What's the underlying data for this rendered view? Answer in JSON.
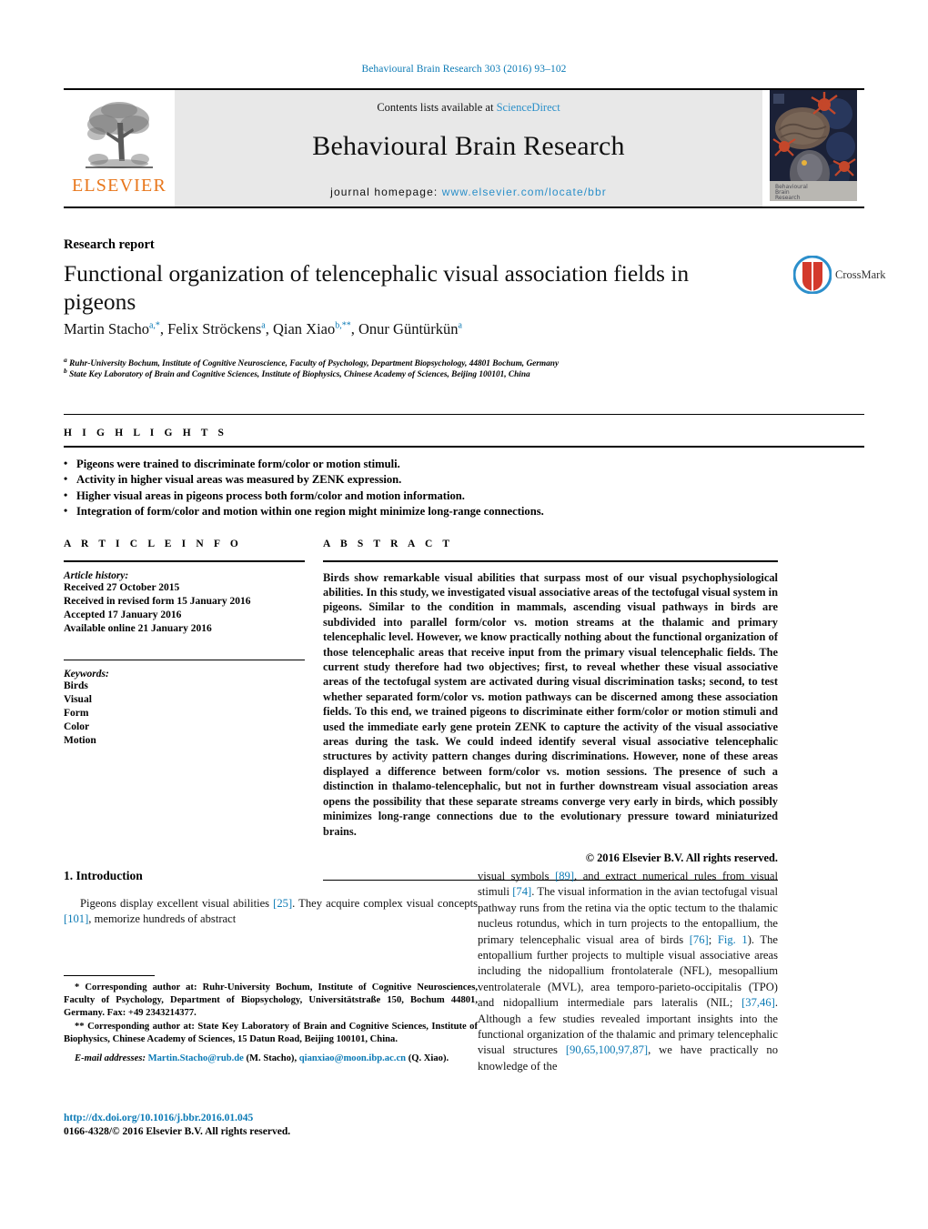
{
  "running_head": "Behavioural Brain Research 303 (2016) 93–102",
  "masthead": {
    "contents_prefix": "Contents lists available at ",
    "sciencedirect": "ScienceDirect",
    "journal_title": "Behavioural Brain Research",
    "homepage_prefix": "journal homepage: ",
    "homepage_url": "www.elsevier.com/locate/bbr",
    "publisher_wordmark": "ELSEVIER",
    "cover_caption_line1": "Behavioural",
    "cover_caption_line2": "Brain",
    "cover_caption_line3": "Research"
  },
  "article": {
    "kind": "Research report",
    "title": "Functional organization of telencephalic visual association fields in pigeons",
    "authors_html": "Martin Stacho<sup>a,*</sup>, Felix Ströckens<sup>a</sup>, Qian Xiao<sup>b,**</sup>, Onur Güntürkün<sup>a</sup>",
    "affiliation_a": "Ruhr-University Bochum, Institute of Cognitive Neuroscience, Faculty of Psychology, Department Biopsychology, 44801 Bochum, Germany",
    "affiliation_b": "State Key Laboratory of Brain and Cognitive Sciences, Institute of Biophysics, Chinese Academy of Sciences, Beijing 100101, China",
    "crossmark_label": "CrossMark"
  },
  "highlights": {
    "label": "H I G H L I G H T S",
    "items": [
      "Pigeons were trained to discriminate form/color or motion stimuli.",
      "Activity in higher visual areas was measured by ZENK expression.",
      "Higher visual areas in pigeons process both form/color and motion information.",
      "Integration of form/color and motion within one region might minimize long-range connections."
    ]
  },
  "article_info": {
    "label": "A R T I C L E   I N F O",
    "history_title": "Article history:",
    "history": [
      "Received 27 October 2015",
      "Received in revised form 15 January 2016",
      "Accepted 17 January 2016",
      "Available online 21 January 2016"
    ],
    "keywords_title": "Keywords:",
    "keywords": [
      "Birds",
      "Visual",
      "Form",
      "Color",
      "Motion"
    ]
  },
  "abstract": {
    "label": "A B S T R A C T",
    "text": "Birds show remarkable visual abilities that surpass most of our visual psychophysiological abilities. In this study, we investigated visual associative areas of the tectofugal visual system in pigeons. Similar to the condition in mammals, ascending visual pathways in birds are subdivided into parallel form/color vs. motion streams at the thalamic and primary telencephalic level. However, we know practically nothing about the functional organization of those telencephalic areas that receive input from the primary visual telencephalic fields. The current study therefore had two objectives; first, to reveal whether these visual associative areas of the tectofugal system are activated during visual discrimination tasks; second, to test whether separated form/color vs. motion pathways can be discerned among these association fields. To this end, we trained pigeons to discriminate either form/color or motion stimuli and used the immediate early gene protein ZENK to capture the activity of the visual associative areas during the task. We could indeed identify several visual associative telencephalic structures by activity pattern changes during discriminations. However, none of these areas displayed a difference between form/color vs. motion sessions. The presence of such a distinction in thalamo-telencephalic, but not in further downstream visual association areas opens the possibility that these separate streams converge very early in birds, which possibly minimizes long-range connections due to the evolutionary pressure toward miniaturized brains.",
    "copyright": "© 2016 Elsevier B.V. All rights reserved."
  },
  "body": {
    "section_heading": "1. Introduction",
    "left_paragraph_html": "Pigeons display excellent visual abilities <span class=\"ref\">[25]</span>. They acquire complex visual concepts <span class=\"ref\">[101]</span>, memorize hundreds of abstract",
    "right_paragraph_html": "visual symbols <span class=\"ref\">[89]</span>, and extract numerical rules from visual stimuli <span class=\"ref\">[74]</span>. The visual information in the avian tectofugal visual pathway runs from the retina via the optic tectum to the thalamic nucleus rotundus, which in turn projects to the entopallium, the primary telencephalic visual area of birds <span class=\"ref\">[76]</span>; <span class=\"ref\">Fig. 1</span>). The entopallium further projects to multiple visual associative areas including the nidopallium frontolaterale (NFL), mesopallium ventrolaterale (MVL), area temporo-parieto-occipitalis (TPO) and nidopallium intermediale pars lateralis (NIL; <span class=\"ref\">[37,46]</span>. Although a few studies revealed important insights into the functional organization of the thalamic and primary telencephalic visual structures <span class=\"ref\">[90,65,100,97,87]</span>, we have practically no knowledge of the"
  },
  "footnotes": {
    "corresponding_1_html": "<span class=\"lead\">* Corresponding author at: Ruhr-University Bochum, Institute of Cognitive Neurosciences, Faculty of Psychology, Department of Biopsychology, Universitätstraße 150, Bochum 44801, Germany. Fax: +49 2343214377.</span>",
    "corresponding_2_html": "<span class=\"lead\">** Corresponding author at: State Key Laboratory of Brain and Cognitive Sciences, Institute of Biophysics, Chinese Academy of Sciences, 15 Datun Road, Beijing 100101, China.</span>",
    "email_html": "<span class=\"lead\"><em>E-mail addresses:</em> <span class=\"link\">Martin.Stacho@rub.de</span> (M. Stacho), <span class=\"link\">qianxiao@moon.ibp.ac.cn</span> (Q. Xiao).</span>"
  },
  "footer": {
    "doi": "http://dx.doi.org/10.1016/j.bbr.2016.01.045",
    "issn_line": "0166-4328/© 2016 Elsevier B.V. All rights reserved."
  },
  "colors": {
    "link_blue": "#0b7ab5",
    "sciencedirect_blue": "#2a8fc9",
    "elsevier_orange": "#e8761b",
    "masthead_grey": "#e8e8e8"
  }
}
